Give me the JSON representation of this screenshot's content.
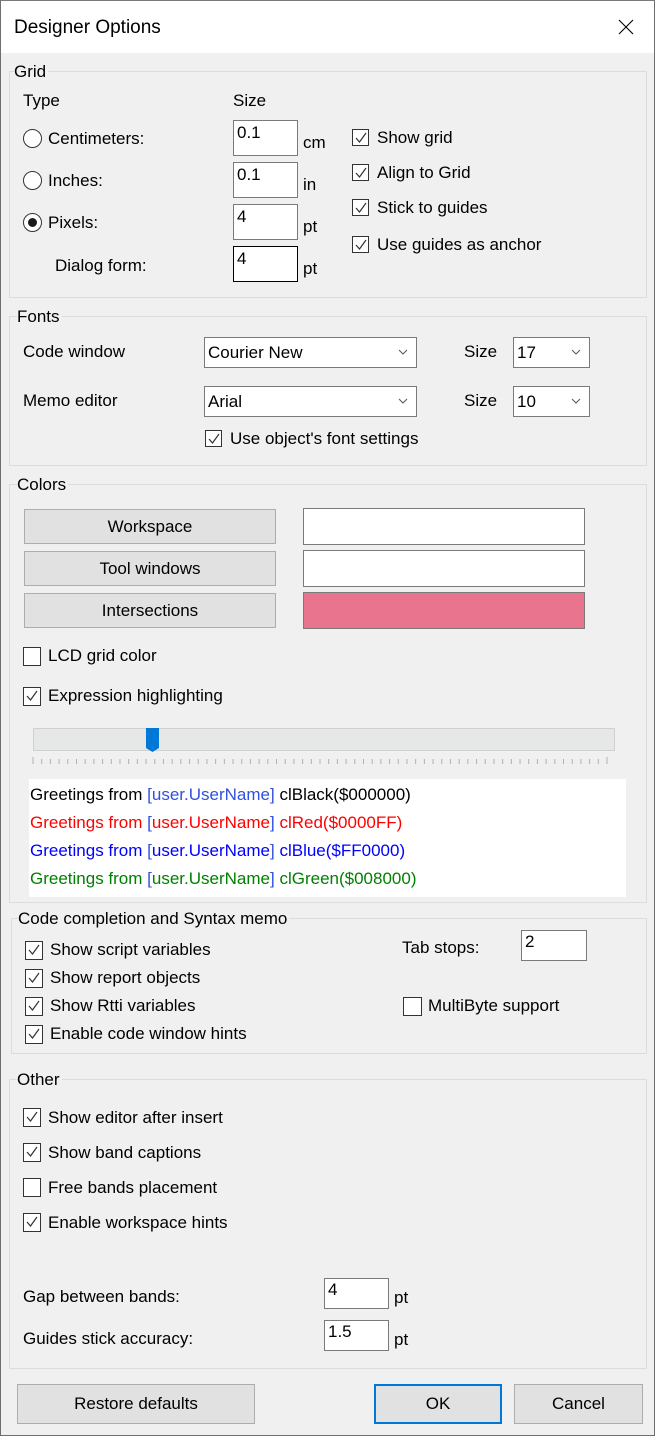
{
  "window": {
    "title": "Designer Options",
    "close_icon": "close-icon"
  },
  "grid": {
    "label": "Grid",
    "type_header": "Type",
    "size_header": "Size",
    "units": [
      {
        "label": "Centimeters:",
        "value": "0.1",
        "unit": "cm",
        "selected": false
      },
      {
        "label": "Inches:",
        "value": "0.1",
        "unit": "in",
        "selected": false
      },
      {
        "label": "Pixels:",
        "value": "4",
        "unit": "pt",
        "selected": true
      }
    ],
    "dialog_form": {
      "label": "Dialog form:",
      "value": "4",
      "unit": "pt"
    },
    "options": [
      {
        "label": "Show grid",
        "checked": true
      },
      {
        "label": "Align to Grid",
        "checked": true
      },
      {
        "label": "Stick to guides",
        "checked": true
      },
      {
        "label": "Use guides as anchor",
        "checked": true
      }
    ]
  },
  "fonts": {
    "label": "Fonts",
    "code_window": {
      "label": "Code window",
      "font": "Courier New",
      "size_label": "Size",
      "size": "17"
    },
    "memo_editor": {
      "label": "Memo editor",
      "font": "Arial",
      "size_label": "Size",
      "size": "10"
    },
    "use_object_font": {
      "label": "Use object's font settings",
      "checked": true
    }
  },
  "colors": {
    "label": "Colors",
    "buttons": [
      {
        "label": "Workspace",
        "color": "#ffffff"
      },
      {
        "label": "Tool windows",
        "color": "#ffffff"
      },
      {
        "label": "Intersections",
        "color": "#e8748e"
      }
    ],
    "lcd_grid_color": {
      "label": "LCD grid color",
      "checked": false
    },
    "expression_highlighting": {
      "label": "Expression highlighting",
      "checked": true
    },
    "slider": {
      "value_fraction": 0.2,
      "accent": "#0078d7"
    },
    "preview": {
      "bracket_color": "#3050e0",
      "lines": [
        {
          "prefix": "Greetings from ",
          "expr_open": "[",
          "expr": "user.UserName",
          "expr_close": "]",
          "suffix": " clBlack($000000)",
          "color": "#000000",
          "expr_color": "#3050e0"
        },
        {
          "prefix": "Greetings from ",
          "expr_open": "[",
          "expr": "user.UserName",
          "expr_close": "]",
          "suffix": " clRed($0000FF)",
          "color": "#ff0000",
          "expr_color": "#ff0000"
        },
        {
          "prefix": "Greetings from ",
          "expr_open": "[",
          "expr": "user.UserName",
          "expr_close": "]",
          "suffix": " clBlue($FF0000)",
          "color": "#0000ff",
          "expr_color": "#0000ff"
        },
        {
          "prefix": "Greetings from ",
          "expr_open": "[",
          "expr": "user.UserName",
          "expr_close": "]",
          "suffix": " clGreen($008000)",
          "color": "#008000",
          "expr_color": "#008000"
        }
      ]
    }
  },
  "code_completion": {
    "label": "Code completion and Syntax memo",
    "options": [
      {
        "label": "Show script variables",
        "checked": true
      },
      {
        "label": "Show report objects",
        "checked": true
      },
      {
        "label": "Show Rtti variables",
        "checked": true
      },
      {
        "label": "Enable code window hints",
        "checked": true
      }
    ],
    "tab_stops": {
      "label": "Tab stops:",
      "value": "2"
    },
    "multibyte": {
      "label": "MultiByte support",
      "checked": false
    }
  },
  "other": {
    "label": "Other",
    "options": [
      {
        "label": "Show editor after insert",
        "checked": true
      },
      {
        "label": "Show band captions",
        "checked": true
      },
      {
        "label": "Free bands placement",
        "checked": false
      },
      {
        "label": "Enable workspace hints",
        "checked": true
      }
    ],
    "gap_between_bands": {
      "label": "Gap between bands:",
      "value": "4",
      "unit": "pt"
    },
    "guides_stick_accuracy": {
      "label": "Guides stick accuracy:",
      "value": "1.5",
      "unit": "pt"
    }
  },
  "footer": {
    "restore_label": "Restore defaults",
    "ok_label": "OK",
    "cancel_label": "Cancel"
  }
}
